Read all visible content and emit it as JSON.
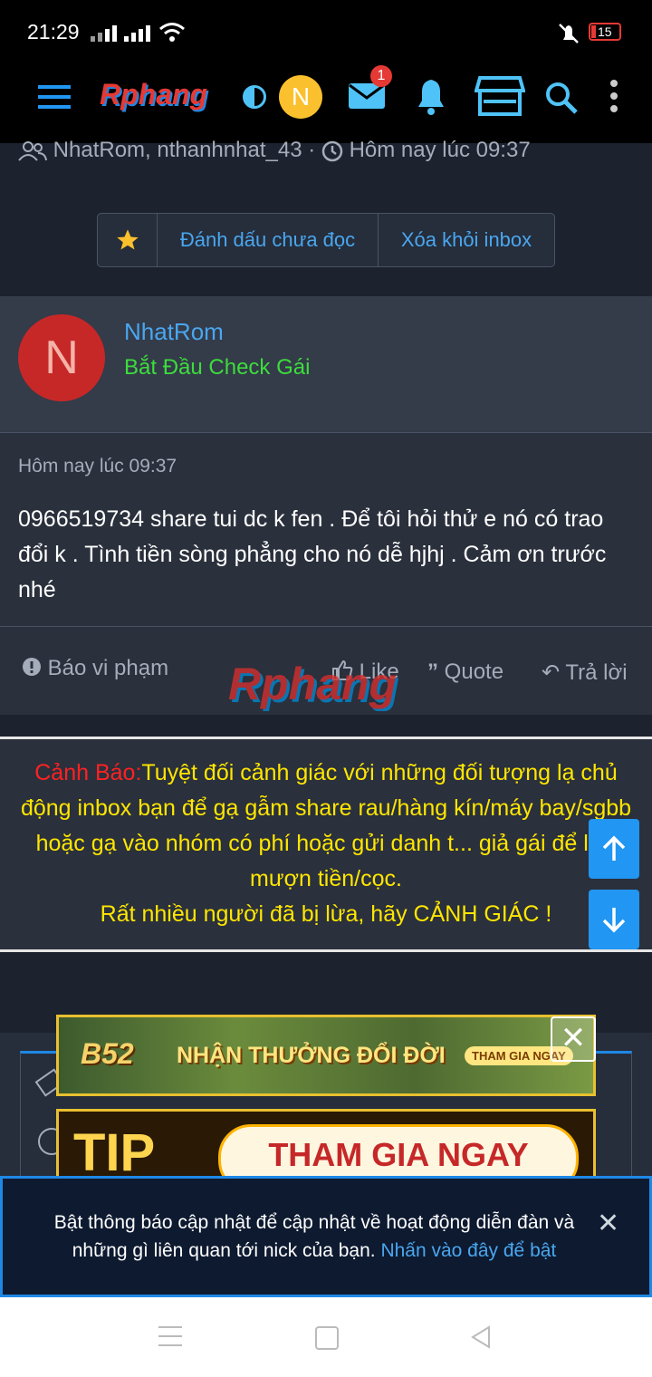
{
  "status_bar": {
    "time": "21:29",
    "battery": "15"
  },
  "nav": {
    "logo": "Rphang",
    "avatar_letter": "N",
    "inbox_badge": "1"
  },
  "thread": {
    "participants": "NhatRom, nthanhnhat_43",
    "separator": "·",
    "time": "Hôm nay lúc 09:37",
    "buttons": {
      "mark_unread": "Đánh dấu chưa đọc",
      "remove_inbox": "Xóa khỏi inbox"
    }
  },
  "message": {
    "avatar_letter": "N",
    "username": "NhatRom",
    "user_title": "Bắt Đầu Check Gái",
    "date": "Hôm nay lúc 09:37",
    "body": "0966519734 share tui dc k fen . Để tôi hỏi thử e nó có trao đổi k . Tình tiền sòng phẳng cho nó dễ hjhj . Cảm ơn trước nhé",
    "actions": {
      "report": "Báo vi phạm",
      "like": "Like",
      "quote": "Quote",
      "reply": "Trả lời"
    },
    "watermark": "Rphang"
  },
  "warning": {
    "label": "Cảnh Báo:",
    "text": "Tuyệt đối cảnh giác với những đối tượng lạ chủ động inbox bạn để gạ gẫm share rau/hàng kín/máy bay/sgbb hoặc gạ vào nhóm có phí hoặc gửi danh t... giả gái để lừa mượn tiền/cọc.",
    "line2": "Rất nhiều người đã bị lừa, hãy CẢNH GIÁC !"
  },
  "ads": {
    "ad1_brand": "B52",
    "ad1_text": "NHẬN THƯỞNG ĐỔI ĐỜI",
    "ad1_cta": "THAM GIA NGAY",
    "ad2_brand": "TIP",
    "ad2_cta": "THAM GIA NGAY"
  },
  "notification": {
    "text": "Bật thông báo cập nhật để cập nhật về hoạt động diễn đàn và những gì liên quan tới nick của bạn.",
    "link": "Nhấn vào đây để bật"
  },
  "colors": {
    "accent": "#49a7ef",
    "green_title": "#3ddc3d",
    "warning_red": "#ff2222",
    "warning_yellow": "#ffe600"
  }
}
